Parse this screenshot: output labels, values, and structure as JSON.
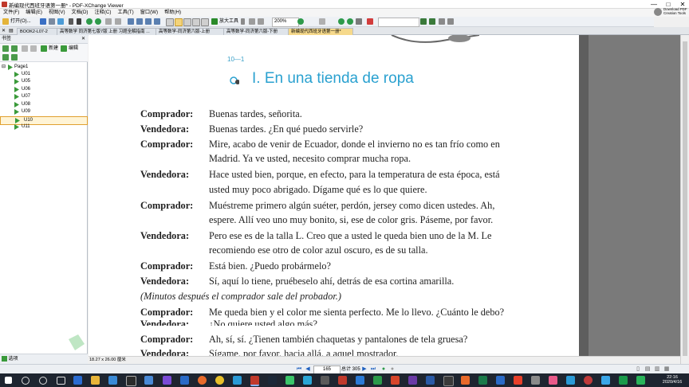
{
  "window": {
    "title": "新编现代西班牙语第一册* - PDF-XChange Viewer",
    "controls": {
      "minimize": "—",
      "maximize": "□",
      "close": "✕"
    }
  },
  "menu": [
    "文件(F)",
    "编辑(E)",
    "视图(V)",
    "文档(D)",
    "注释(C)",
    "工具(T)",
    "窗口(W)",
    "帮助(H)"
  ],
  "promo": {
    "line1": "Download PDF",
    "line2": "Creation Tools"
  },
  "toolbar": {
    "open_label": "打开(O)...",
    "zoom_tool_label": "放大工具",
    "zoom_value": "200%"
  },
  "tabs": [
    "BOOK2-L07-2",
    "高等数学 同济第七版7版 上册 习题全解指南 ...",
    "高等数学-同济第六版-上册",
    "高等数学-同济第六版-下册",
    "新编现代西班牙语第一册*"
  ],
  "bookmarks": {
    "panel_title": "书签",
    "new_label": "新建",
    "edit_label": "编辑",
    "items": [
      "Page1",
      "U01",
      "U05",
      "U06",
      "U07",
      "U08",
      "U09",
      "U10",
      "U11"
    ],
    "selected": "U10",
    "status_label": "选项"
  },
  "page": {
    "section_number": "10—1",
    "title": "I. En una tienda de ropa",
    "lines": [
      {
        "speaker": "Comprador:",
        "text": "Buenas tardes, señorita."
      },
      {
        "speaker": "Vendedora:",
        "text": "Buenas tardes. ¿En qué puedo servirle?"
      },
      {
        "speaker": "Comprador:",
        "text": "Mire, acabo de venir de Ecuador, donde el invierno no es tan frío como en"
      },
      {
        "speaker": "",
        "text": "Madrid. Ya ve usted, necesito comprar mucha ropa."
      },
      {
        "speaker": "Vendedora:",
        "text": "Hace usted bien, porque, en efecto, para la temperatura de esta época, está"
      },
      {
        "speaker": "",
        "text": "usted muy poco abrigado. Dígame qué es lo que quiere."
      },
      {
        "speaker": "Comprador:",
        "text": "Muéstreme primero algún suéter, perdón, jersey como dicen ustedes. Ah,"
      },
      {
        "speaker": "",
        "text": "espere. Allí veo uno muy bonito, si, ese de color gris. Páseme, por favor."
      },
      {
        "speaker": "Vendedora:",
        "text": "Pero ese es de la talla L. Creo que a usted le queda bien uno de la M. Le"
      },
      {
        "speaker": "",
        "text": "recomiendo ese otro de color azul oscuro, es de su talla."
      },
      {
        "speaker": "Comprador:",
        "text": "Está bien. ¿Puedo probármelo?"
      },
      {
        "speaker": "Vendedora:",
        "text": "Sí, aquí lo tiene, pruébeselo ahí, detrás de esa cortina amarilla."
      },
      {
        "speaker": "",
        "text": "(Minutos después el comprador sale del probador.)",
        "direction": true
      },
      {
        "speaker": "Comprador:",
        "text": "Me queda bien y el color me sienta perfecto. Me lo llevo. ¿Cuánto le debo?"
      },
      {
        "speaker": "Vendedora:",
        "text": "¿No quiere usted algo más?"
      },
      {
        "speaker": "Comprador:",
        "text": "Ah, sí, sí. ¿Tienen también chaquetas y pantalones de tela gruesa?"
      },
      {
        "speaker": "Vendedora:",
        "text": "Sígame, por favor, hacia allá, a aquel mostrador."
      }
    ]
  },
  "page_size": "18.27 x 26.00 厘米",
  "navigation": {
    "current_page": "165",
    "total_label": "总计 305"
  },
  "clock": {
    "time": "22:16",
    "date": "2020/4/16"
  }
}
